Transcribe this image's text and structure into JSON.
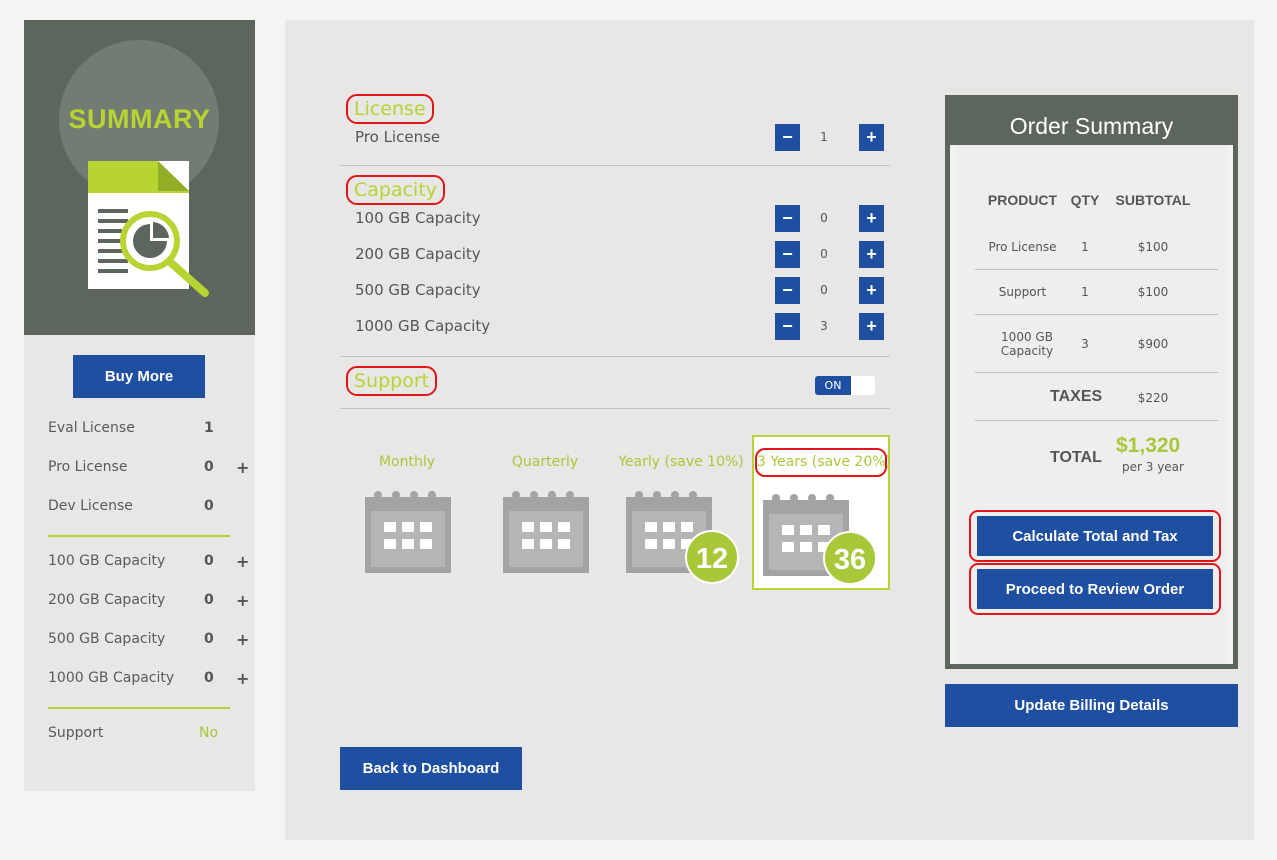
{
  "sidebar": {
    "title": "SUMMARY",
    "buy_more_label": "Buy More",
    "licenses": [
      {
        "label": "Eval License",
        "value": "1"
      },
      {
        "label": "Pro License",
        "value": "0",
        "plus": "+"
      },
      {
        "label": "Dev License",
        "value": "0"
      }
    ],
    "capacities": [
      {
        "label": "100 GB Capacity",
        "value": "0",
        "plus": "+"
      },
      {
        "label": "200 GB Capacity",
        "value": "0",
        "plus": "+"
      },
      {
        "label": "500 GB Capacity",
        "value": "0",
        "plus": "+"
      },
      {
        "label": "1000 GB Capacity",
        "value": "0",
        "plus": "+"
      }
    ],
    "support": {
      "label": "Support",
      "value": "No"
    }
  },
  "main": {
    "license": {
      "title": "License",
      "items": [
        {
          "label": "Pro License",
          "qty": "1"
        }
      ]
    },
    "capacity": {
      "title": "Capacity",
      "items": [
        {
          "label": "100 GB Capacity",
          "qty": "0"
        },
        {
          "label": "200 GB Capacity",
          "qty": "0"
        },
        {
          "label": "500 GB Capacity",
          "qty": "0"
        },
        {
          "label": "1000 GB Capacity",
          "qty": "3"
        }
      ]
    },
    "support": {
      "title": "Support",
      "toggle": "ON"
    },
    "plans": [
      {
        "label": "Monthly"
      },
      {
        "label": "Quarterly"
      },
      {
        "label": "Yearly (save 10%)",
        "badge": "12"
      },
      {
        "label": "3 Years (save 20%)",
        "badge": "36",
        "selected": true
      }
    ],
    "qty_minus": "−",
    "qty_plus": "+",
    "back_label": "Back to Dashboard"
  },
  "order_summary": {
    "title": "Order Summary",
    "headers": [
      "PRODUCT",
      "QTY",
      "SUBTOTAL"
    ],
    "rows": [
      {
        "product": "Pro License",
        "qty": "1",
        "subtotal": "$100"
      },
      {
        "product": "Support",
        "qty": "1",
        "subtotal": "$100"
      },
      {
        "product": "1000 GB Capacity",
        "qty": "3",
        "subtotal": "$900"
      }
    ],
    "taxes_label": "TAXES",
    "taxes_value": "$220",
    "total_label": "TOTAL",
    "total_value": "$1,320",
    "total_period": "per 3 year",
    "calculate_label": "Calculate Total and Tax",
    "proceed_label": "Proceed to Review Order",
    "billing_label": "Update Billing Details"
  },
  "colors": {
    "brand_blue": "#1f4fa1",
    "accent_green": "#b7d433",
    "panel_dark": "#5d665c",
    "highlight_red": "#e0161a"
  },
  "icons": {
    "hero": "document-magnifier-icon",
    "plan": "calendar-icon"
  }
}
